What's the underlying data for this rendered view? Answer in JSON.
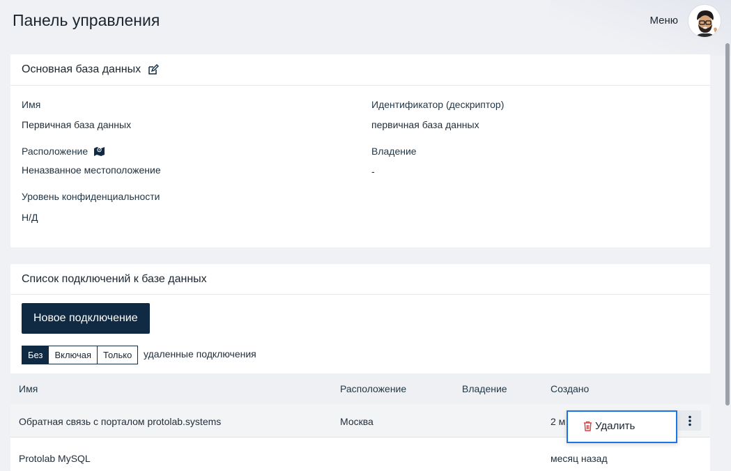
{
  "header": {
    "title": "Панель управления",
    "menu_label": "Меню"
  },
  "database_card": {
    "title": "Основная база данных",
    "fields": {
      "name_label": "Имя",
      "name_value": "Первичная база данных",
      "identifier_label": "Идентификатор (дескриптор)",
      "identifier_value": "первичная база данных",
      "location_label": "Расположение",
      "location_value": "Неназванное местоположение",
      "ownership_label": "Владение",
      "ownership_value": "-",
      "confidentiality_label": "Уровень конфиденциальности",
      "confidentiality_value": "Н/Д"
    }
  },
  "connections_card": {
    "title": "Список подключений к базе данных",
    "new_button": "Новое подключение",
    "filter": {
      "options": [
        "Без",
        "Включая",
        "Только"
      ],
      "selected": "Без",
      "caption": "удаленные подключения"
    },
    "columns": [
      "Имя",
      "Расположение",
      "Владение",
      "Создано"
    ],
    "rows": [
      {
        "name": "Обратная связь с порталом protolab.systems",
        "location": "Москва",
        "ownership": "",
        "created": "2 м"
      },
      {
        "name": "Protolab MySQL",
        "location": "",
        "ownership": "",
        "created": "месяц назад"
      }
    ],
    "row_menu": {
      "delete_label": "Удалить"
    }
  },
  "colors": {
    "primary": "#102a43",
    "focus_border": "#1a73e8",
    "delete_icon": "#e53935"
  }
}
